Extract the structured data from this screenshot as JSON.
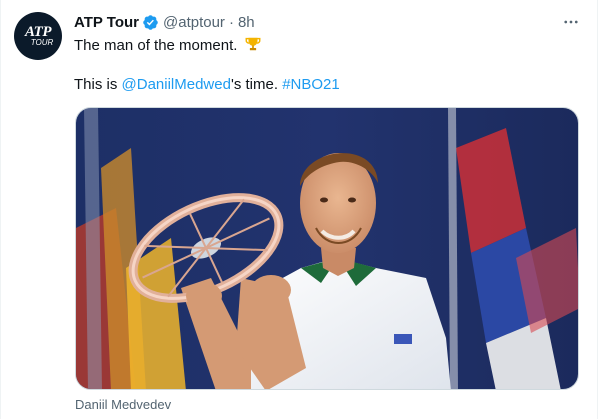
{
  "tweet": {
    "author_name": "ATP Tour",
    "author_handle": "@atptour",
    "separator": "·",
    "timestamp": "8h",
    "avatar_text_main": "ATP",
    "avatar_text_sub": "TOUR",
    "line1_text": "The man of the moment.",
    "line2_prefix": "This is ",
    "mention": "@DaniilMedwed",
    "line2_middle": "'s time. ",
    "hashtag": "#NBO21",
    "media_caption": "Daniil Medvedev",
    "more_icon": "more-horizontal-icon",
    "verified_icon": "verified-badge-icon",
    "trophy_icon": "trophy-emoji-icon"
  },
  "colors": {
    "link": "#1d9bf0",
    "secondary_text": "#536471",
    "verified": "#1d9bf0",
    "avatar_bg": "#0b1a2a"
  }
}
